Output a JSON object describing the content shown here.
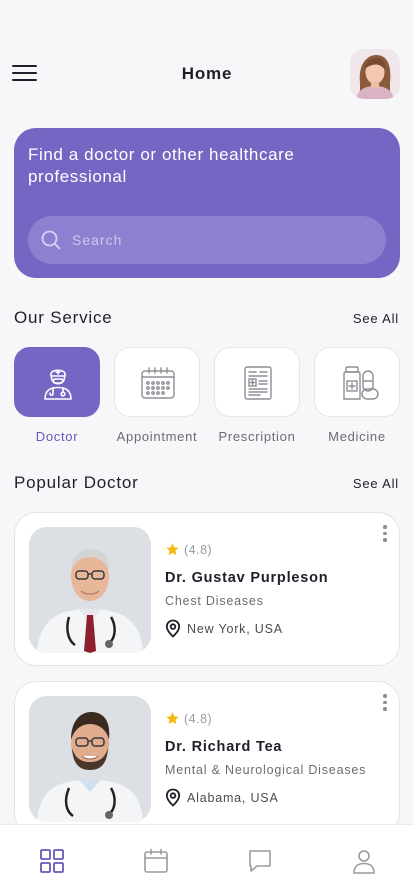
{
  "header": {
    "title": "Home"
  },
  "hero": {
    "title": "Find a doctor or other healthcare professional",
    "search_placeholder": "Search"
  },
  "services": {
    "title": "Our Service",
    "see_all": "See All",
    "items": [
      {
        "label": "Doctor",
        "icon": "doctor-icon",
        "active": true
      },
      {
        "label": "Appointment",
        "icon": "calendar-icon",
        "active": false
      },
      {
        "label": "Prescription",
        "icon": "prescription-icon",
        "active": false
      },
      {
        "label": "Medicine",
        "icon": "medicine-icon",
        "active": false
      }
    ]
  },
  "popular": {
    "title": "Popular Doctor",
    "see_all": "See All",
    "doctors": [
      {
        "rating": "(4.8)",
        "name": "Dr. Gustav Purpleson",
        "specialty": "Chest Diseases",
        "location": "New York, USA"
      },
      {
        "rating": "(4.8)",
        "name": "Dr. Richard Tea",
        "specialty": "Mental & Neurological Diseases",
        "location": "Alabama, USA"
      }
    ]
  },
  "bottom_nav": [
    {
      "icon": "home-grid-icon",
      "active": true
    },
    {
      "icon": "calendar-icon",
      "active": false
    },
    {
      "icon": "chat-icon",
      "active": false
    },
    {
      "icon": "profile-icon",
      "active": false
    }
  ],
  "colors": {
    "accent": "#7765c3",
    "star": "#f5b80f",
    "background": "#f7f7f9"
  }
}
